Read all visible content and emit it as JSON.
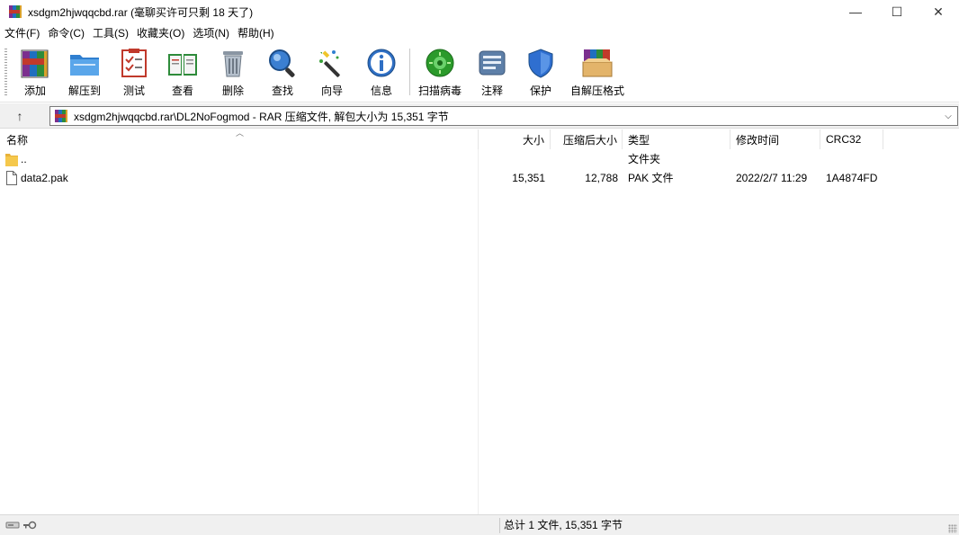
{
  "window": {
    "title": "xsdgm2hjwqqcbd.rar",
    "title_suffix": "(毫聊买许可只剩 18 天了)",
    "controls": {
      "minimize": "—",
      "maximize": "☐",
      "close": "✕"
    }
  },
  "menu": [
    "文件(F)",
    "命令(C)",
    "工具(S)",
    "收藏夹(O)",
    "选项(N)",
    "帮助(H)"
  ],
  "toolbar": {
    "add": "添加",
    "extract": "解压到",
    "test": "测试",
    "view": "查看",
    "delete": "删除",
    "find": "查找",
    "wizard": "向导",
    "info": "信息",
    "virus": "扫描病毒",
    "comment": "注释",
    "protect": "保护",
    "sfx": "自解压格式"
  },
  "address": {
    "up": "↑",
    "path": "xsdgm2hjwqqcbd.rar\\DL2NoFogmod - RAR 压缩文件, 解包大小为 15,351 字节",
    "dropdown": "⌵"
  },
  "columns": {
    "name": "名称",
    "size": "大小",
    "packed": "压缩后大小",
    "type": "类型",
    "modified": "修改时间",
    "crc": "CRC32"
  },
  "files": [
    {
      "name": "..",
      "size": "",
      "packed": "",
      "type": "文件夹",
      "modified": "",
      "crc": ""
    },
    {
      "name": "data2.pak",
      "size": "15,351",
      "packed": "12,788",
      "type": "PAK 文件",
      "modified": "2022/2/7 11:29",
      "crc": "1A4874FD"
    }
  ],
  "status": {
    "text": "总计 1 文件, 15,351 字节"
  },
  "colors": {
    "accent_blue": "#2b78c6",
    "folder_yellow": "#f5c84c",
    "green": "#3aa13a"
  }
}
